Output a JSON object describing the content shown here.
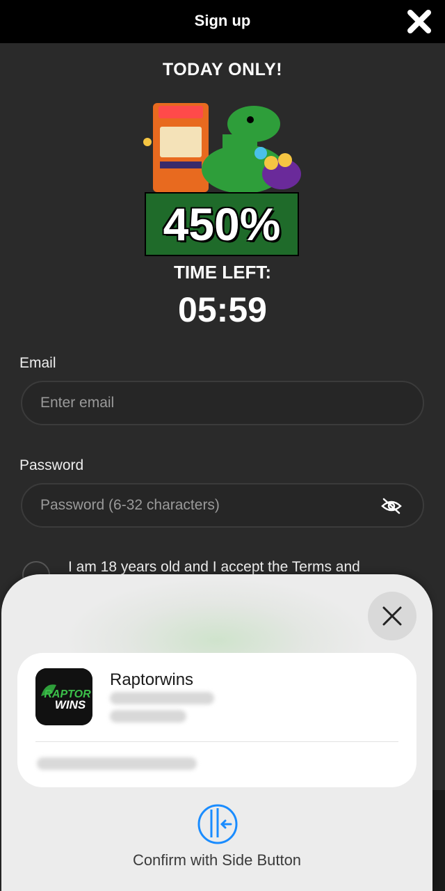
{
  "header": {
    "title": "Sign up"
  },
  "promo": {
    "headline": "TODAY ONLY!",
    "bonus": "450%",
    "time_left_label": "TIME LEFT:",
    "countdown": "05:59"
  },
  "form": {
    "email_label": "Email",
    "email_placeholder": "Enter email",
    "password_label": "Password",
    "password_placeholder": "Password (6-32 characters)",
    "terms_text": "I am 18 years old and I accept the Terms and"
  },
  "sheet": {
    "app_name": "Raptorwins",
    "app_icon_text_top": "RAPTOR",
    "app_icon_text_bottom": "WINS",
    "confirm_text": "Confirm with Side Button"
  },
  "colors": {
    "accent_blue": "#1a8cff",
    "badge_green": "#1f6b2a",
    "background": "#2a2a2a"
  }
}
